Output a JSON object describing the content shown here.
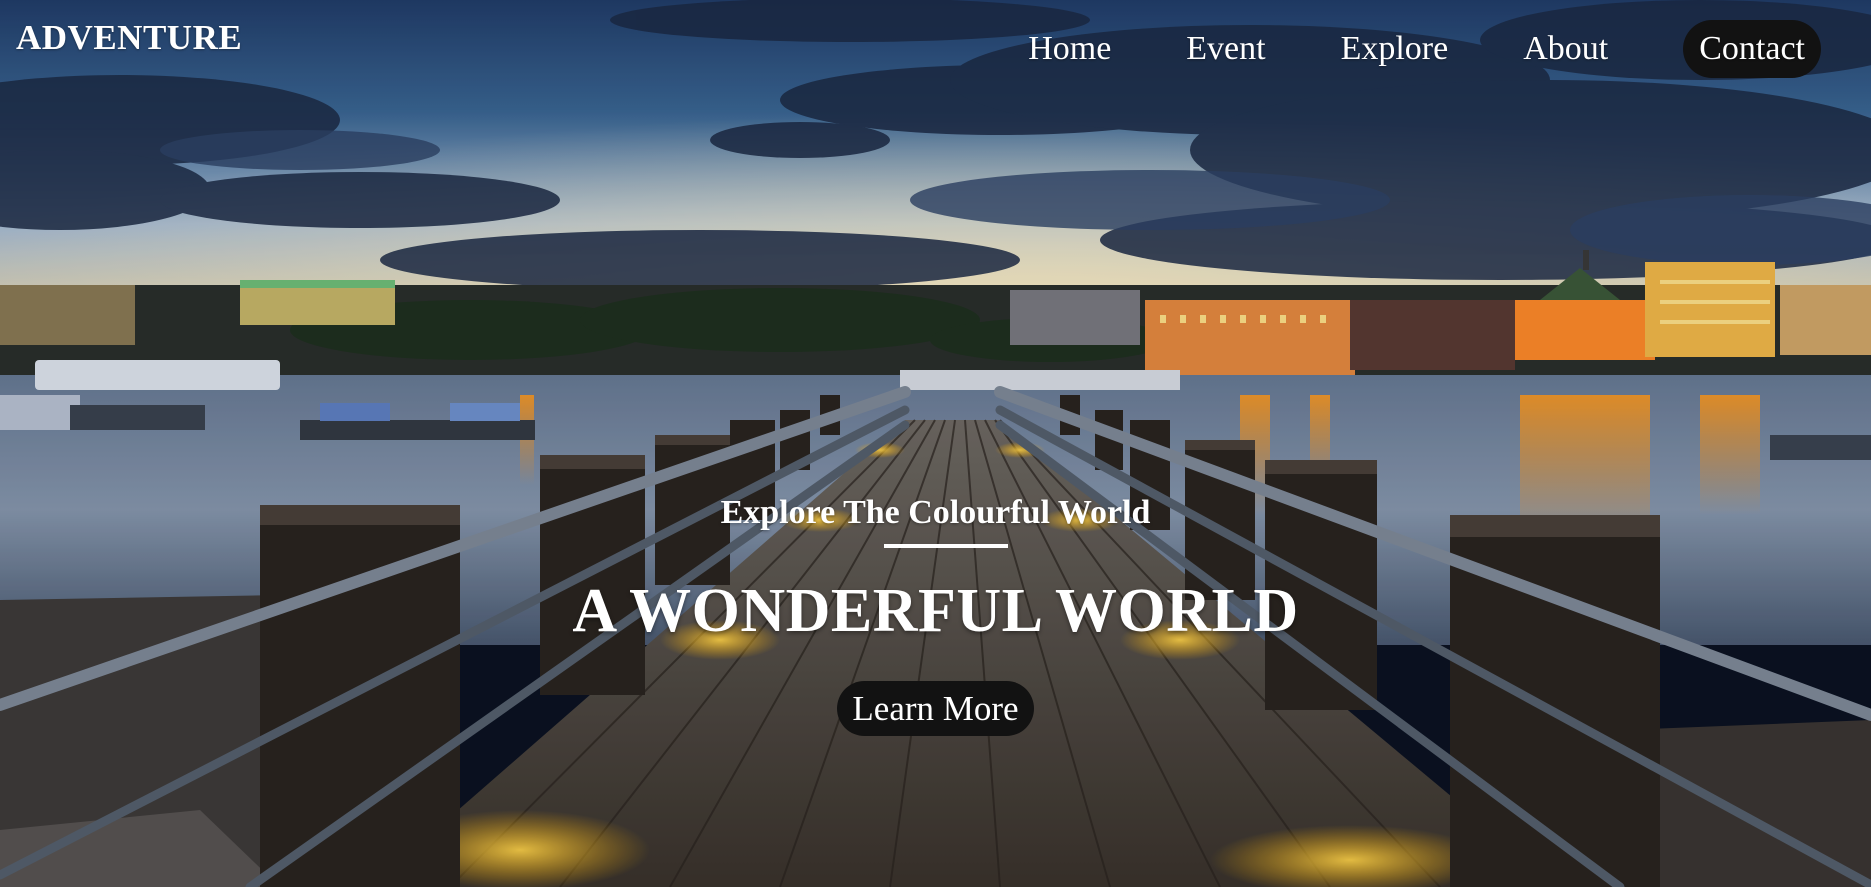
{
  "brand": {
    "name": "ADVENTURE"
  },
  "nav": {
    "items": [
      {
        "label": "Home"
      },
      {
        "label": "Event"
      },
      {
        "label": "Explore"
      },
      {
        "label": "About"
      },
      {
        "label": "Contact",
        "active": true
      }
    ]
  },
  "hero": {
    "subtitle": "Explore The Colourful World",
    "title": "A WONDERFUL WORLD",
    "cta_label": "Learn More",
    "background_image": "dusk-river-pier-photo"
  },
  "colors": {
    "pill_background": "#121212",
    "text": "#ffffff"
  }
}
